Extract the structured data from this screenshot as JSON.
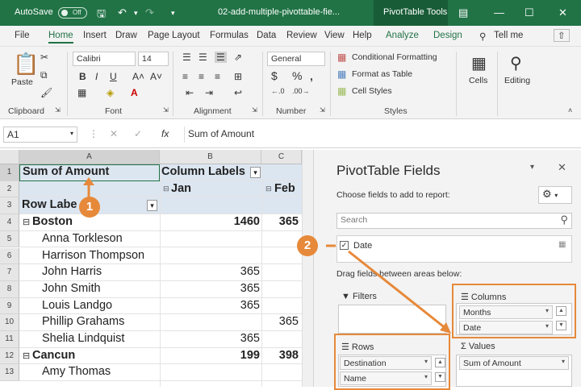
{
  "titlebar": {
    "autosave": "AutoSave",
    "autosave_state": "Off",
    "filename": "02-add-multiple-pivottable-fie...",
    "context_tab": "PivotTable Tools"
  },
  "menu": [
    "File",
    "Home",
    "Insert",
    "Draw",
    "Page Layout",
    "Formulas",
    "Data",
    "Review",
    "View",
    "Help",
    "Analyze",
    "Design"
  ],
  "tell_me": "Tell me",
  "ribbon": {
    "paste": "Paste",
    "font_name": "Calibri",
    "font_size": "14",
    "number_format": "General",
    "conditional_formatting": "Conditional Formatting",
    "format_as_table": "Format as Table",
    "cell_styles": "Cell Styles",
    "cells": "Cells",
    "editing": "Editing",
    "groups": {
      "clipboard": "Clipboard",
      "font": "Font",
      "alignment": "Alignment",
      "number": "Number",
      "styles": "Styles"
    }
  },
  "formula_bar": {
    "name_box": "A1",
    "fx": "fx",
    "content": "Sum of Amount"
  },
  "sheet": {
    "columns": [
      "A",
      "B",
      "C"
    ],
    "rows": [
      {
        "n": "1",
        "a": "Sum of Amount",
        "b": "Column Labels",
        "c": ""
      },
      {
        "n": "2",
        "a": "",
        "b": "Jan",
        "c": "Feb"
      },
      {
        "n": "3",
        "a": "Row Labe",
        "b": "",
        "c": ""
      },
      {
        "n": "4",
        "a": "Boston",
        "b": "1460",
        "c": "365"
      },
      {
        "n": "5",
        "a": "Anna Torkleson",
        "b": "",
        "c": ""
      },
      {
        "n": "6",
        "a": "Harrison Thompson",
        "b": "",
        "c": ""
      },
      {
        "n": "7",
        "a": "John Harris",
        "b": "365",
        "c": ""
      },
      {
        "n": "8",
        "a": "John Smith",
        "b": "365",
        "c": ""
      },
      {
        "n": "9",
        "a": "Louis Landgo",
        "b": "365",
        "c": ""
      },
      {
        "n": "10",
        "a": "Phillip Grahams",
        "b": "",
        "c": "365"
      },
      {
        "n": "11",
        "a": "Shelia Lindquist",
        "b": "365",
        "c": ""
      },
      {
        "n": "12",
        "a": "Cancun",
        "b": "199",
        "c": "398"
      },
      {
        "n": "13",
        "a": "Amy Thomas",
        "b": "",
        "c": ""
      }
    ]
  },
  "callouts": {
    "one": "1",
    "two": "2"
  },
  "pane": {
    "title": "PivotTable Fields",
    "subtitle": "Choose fields to add to report:",
    "search_placeholder": "Search",
    "field_date": "Date",
    "drag_hint": "Drag fields between areas below:",
    "filters": "Filters",
    "columns": "Columns",
    "rows": "Rows",
    "values": "Values",
    "columns_items": [
      "Months",
      "Date"
    ],
    "rows_items": [
      "Destination",
      "Name"
    ],
    "values_items": [
      "Sum of Amount"
    ]
  },
  "colors": {
    "excel_green": "#217346",
    "callout_orange": "#e6893a",
    "pivot_header": "#dce6f1"
  }
}
